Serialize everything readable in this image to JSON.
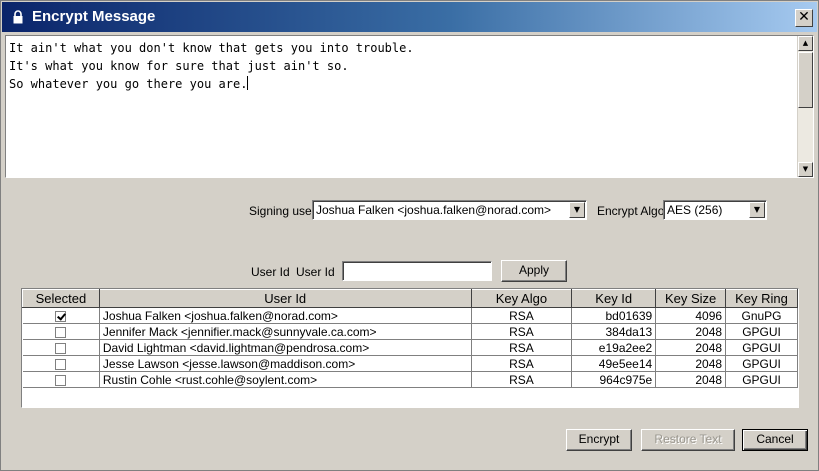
{
  "window": {
    "title": "Encrypt Message",
    "close_glyph": "✕"
  },
  "editor": {
    "lines": [
      "It ain't what you don't know that gets you into trouble.",
      "It's what you know for sure that just ain't so.",
      "So whatever you go there you are."
    ]
  },
  "signing": {
    "label": "Signing user",
    "value": "Joshua Falken <joshua.falken@norad.com>"
  },
  "encrypt_algo": {
    "label": "Encrypt Algo",
    "value": "AES (256)"
  },
  "filter": {
    "label1": "User Id",
    "label2": "User Id",
    "value": "",
    "apply_label": "Apply"
  },
  "table": {
    "columns": [
      "Selected",
      "User Id",
      "Key Algo",
      "Key Id",
      "Key Size",
      "Key Ring"
    ],
    "rows": [
      {
        "selected": true,
        "user_id": "Joshua Falken <joshua.falken@norad.com>",
        "key_algo": "RSA",
        "key_id": "bd01639",
        "key_size": "4096",
        "key_ring": "GnuPG"
      },
      {
        "selected": false,
        "user_id": "Jennifer Mack <jennifier.mack@sunnyvale.ca.com>",
        "key_algo": "RSA",
        "key_id": "384da13",
        "key_size": "2048",
        "key_ring": "GPGUI"
      },
      {
        "selected": false,
        "user_id": "David Lightman <david.lightman@pendrosa.com>",
        "key_algo": "RSA",
        "key_id": "e19a2ee2",
        "key_size": "2048",
        "key_ring": "GPGUI"
      },
      {
        "selected": false,
        "user_id": "Jesse Lawson <jesse.lawson@maddison.com>",
        "key_algo": "RSA",
        "key_id": "49e5ee14",
        "key_size": "2048",
        "key_ring": "GPGUI"
      },
      {
        "selected": false,
        "user_id": "Rustin Cohle <rust.cohle@soylent.com>",
        "key_algo": "RSA",
        "key_id": "964c975e",
        "key_size": "2048",
        "key_ring": "GPGUI"
      }
    ]
  },
  "buttons": {
    "encrypt": "Encrypt",
    "restore": "Restore Text",
    "cancel": "Cancel"
  },
  "icons": {
    "title": "lock-icon",
    "scroll_up": "arrow-up-icon",
    "scroll_down": "arrow-down-icon",
    "dropdown": "chevron-down-icon"
  }
}
